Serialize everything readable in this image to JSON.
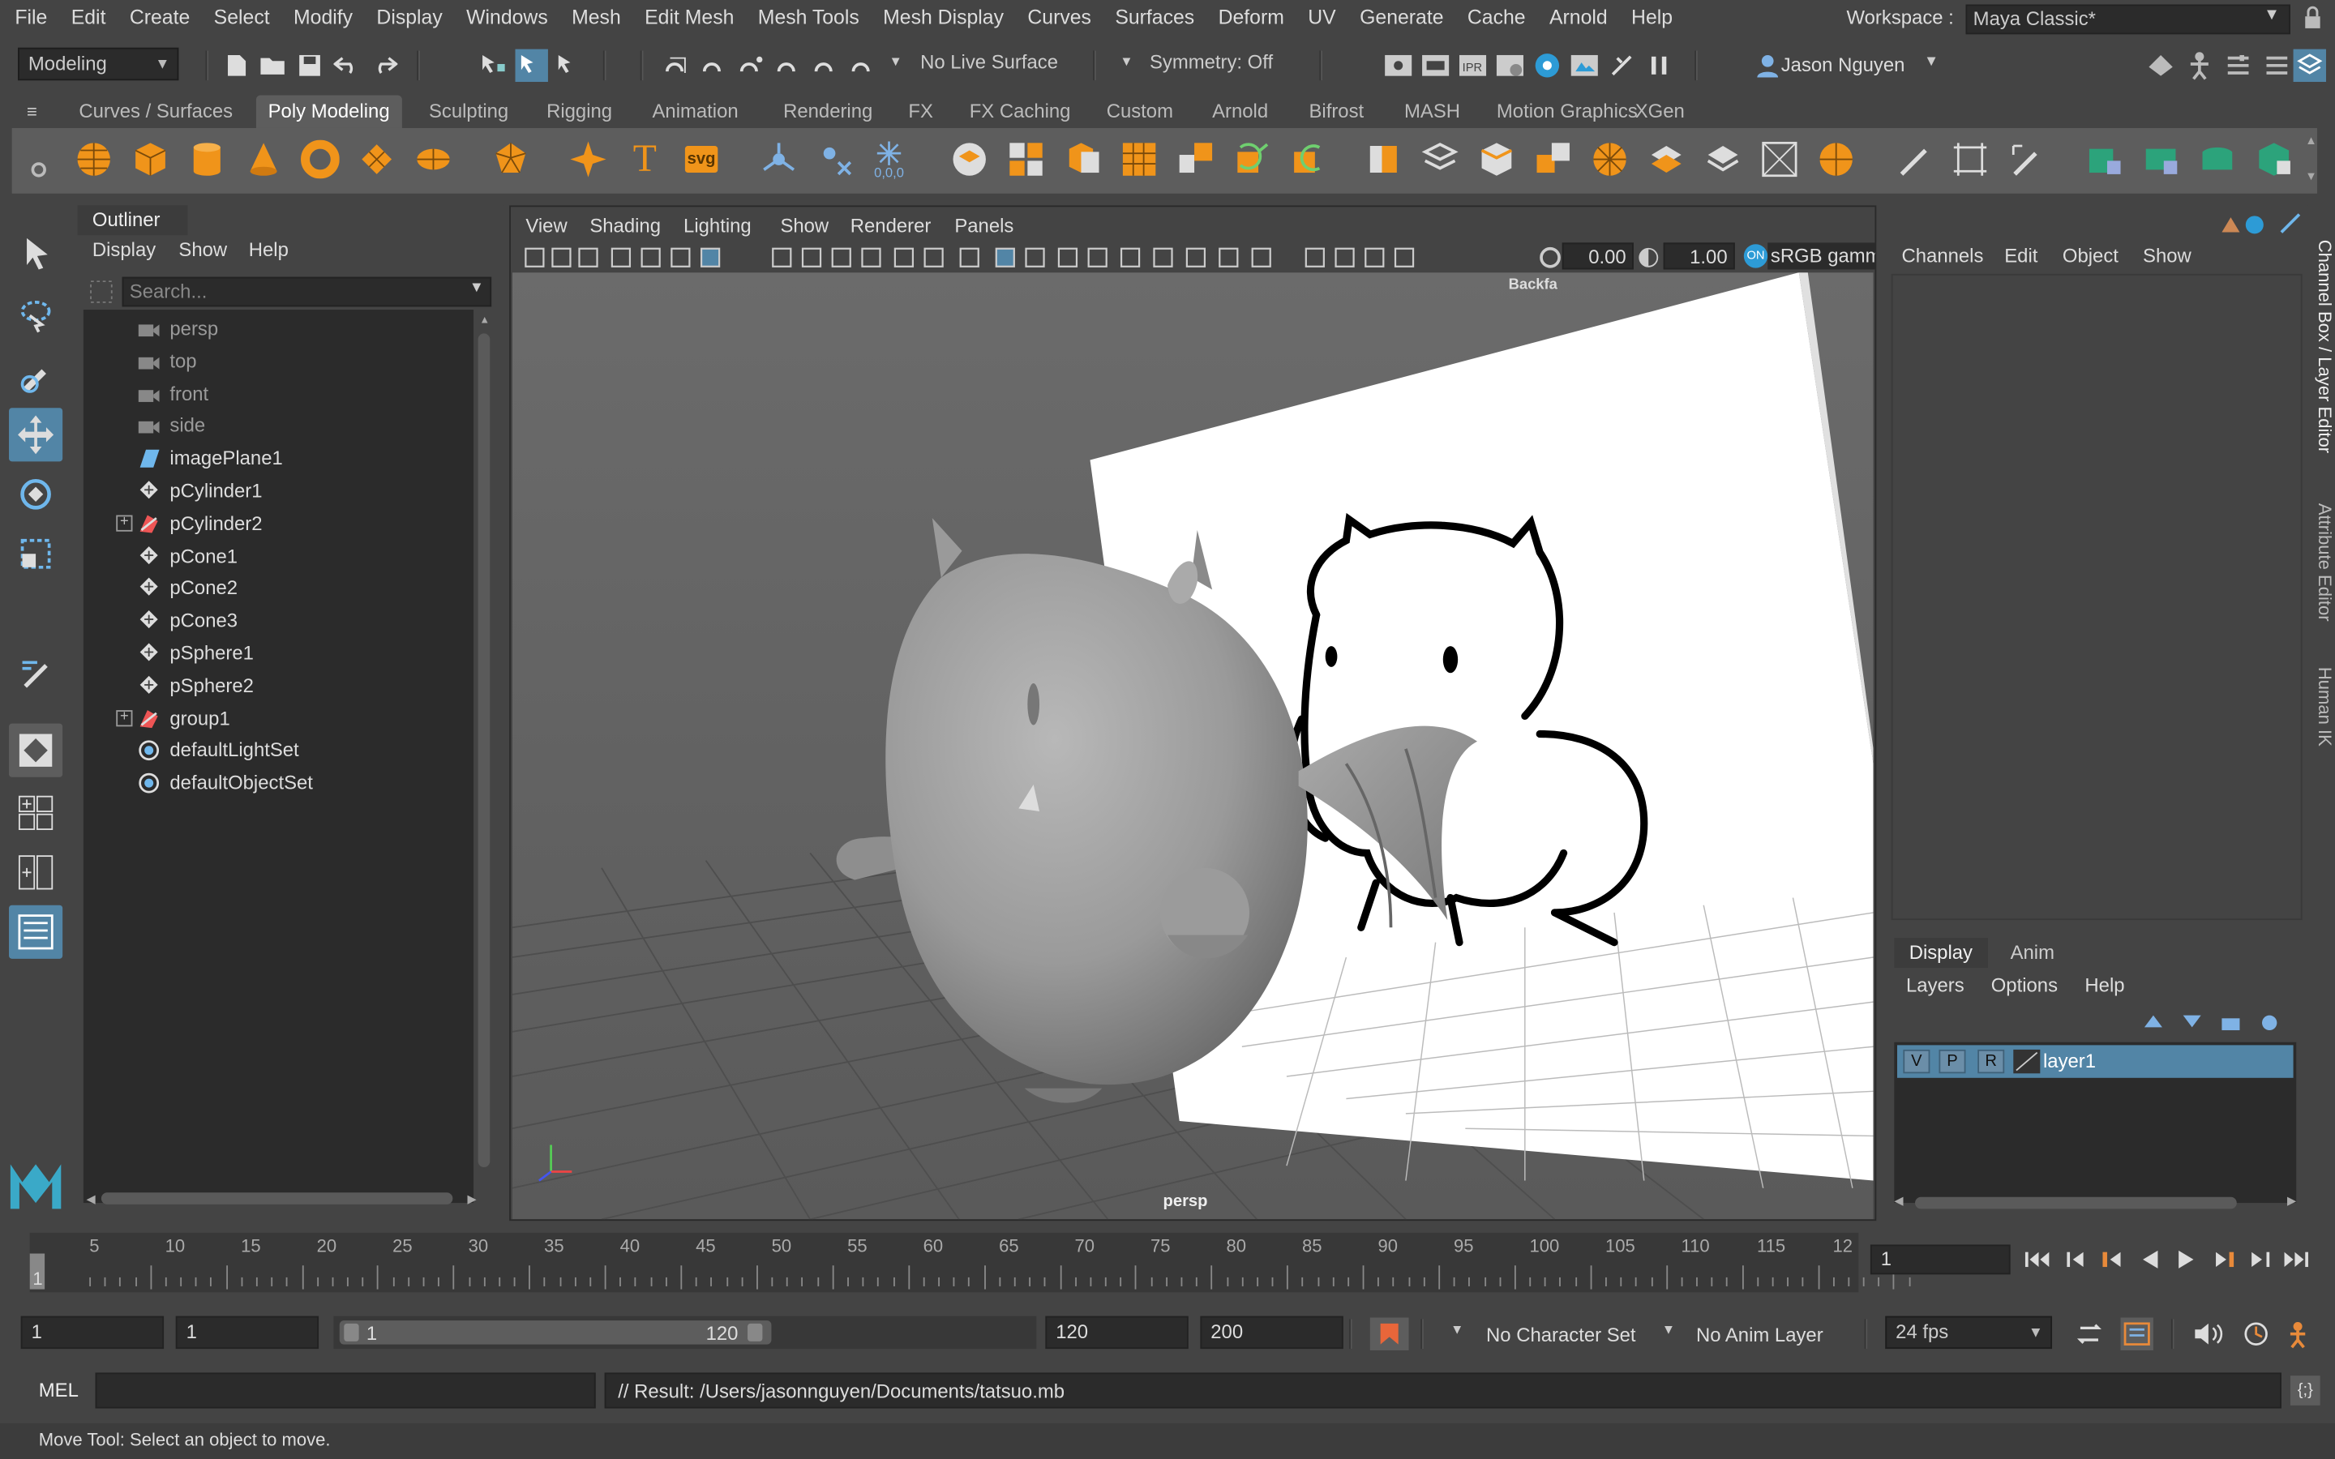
{
  "menubar": {
    "items": [
      "File",
      "Edit",
      "Create",
      "Select",
      "Modify",
      "Display",
      "Windows",
      "Mesh",
      "Edit Mesh",
      "Mesh Tools",
      "Mesh Display",
      "Curves",
      "Surfaces",
      "Deform",
      "UV",
      "Generate",
      "Cache",
      "Arnold",
      "Help"
    ],
    "workspace_label": "Workspace :",
    "workspace_value": "Maya Classic*"
  },
  "statusline": {
    "menuset": "Modeling",
    "live_surface": "No Live Surface",
    "symmetry": "Symmetry: Off",
    "user": "Jason Nguyen"
  },
  "shelf": {
    "tabs": [
      "Curves / Surfaces",
      "Poly Modeling",
      "Sculpting",
      "Rigging",
      "Animation",
      "Rendering",
      "FX",
      "FX Caching",
      "Custom",
      "Arnold",
      "Bifrost",
      "MASH",
      "Motion Graphics",
      "XGen"
    ],
    "active_tab": "Poly Modeling",
    "svg_label": "svg",
    "coords_label": "0,0,0"
  },
  "outliner": {
    "title": "Outliner",
    "menu": [
      "Display",
      "Show",
      "Help"
    ],
    "search_placeholder": "Search...",
    "items": [
      {
        "name": "persp",
        "kind": "camera"
      },
      {
        "name": "top",
        "kind": "camera"
      },
      {
        "name": "front",
        "kind": "camera"
      },
      {
        "name": "side",
        "kind": "camera"
      },
      {
        "name": "imagePlane1",
        "kind": "imageplane"
      },
      {
        "name": "pCylinder1",
        "kind": "mesh"
      },
      {
        "name": "pCylinder2",
        "kind": "group"
      },
      {
        "name": "pCone1",
        "kind": "mesh"
      },
      {
        "name": "pCone2",
        "kind": "mesh"
      },
      {
        "name": "pCone3",
        "kind": "mesh"
      },
      {
        "name": "pSphere1",
        "kind": "mesh"
      },
      {
        "name": "pSphere2",
        "kind": "mesh"
      },
      {
        "name": "group1",
        "kind": "group"
      },
      {
        "name": "defaultLightSet",
        "kind": "set"
      },
      {
        "name": "defaultObjectSet",
        "kind": "set"
      }
    ]
  },
  "viewport": {
    "menu": [
      "View",
      "Shading",
      "Lighting",
      "Show",
      "Renderer",
      "Panels"
    ],
    "exposure": "0.00",
    "gamma": "1.00",
    "colorspace": "sRGB gamm",
    "camera_label": "persp",
    "hud_label": "Backfa"
  },
  "channelbox": {
    "menu": [
      "Channels",
      "Edit",
      "Object",
      "Show"
    ],
    "layer_tabs": [
      "Display",
      "Anim"
    ],
    "layer_menu": [
      "Layers",
      "Options",
      "Help"
    ],
    "layer": {
      "v": "V",
      "p": "P",
      "r": "R",
      "name": "layer1"
    }
  },
  "side_tabs": [
    "Channel Box / Layer Editor",
    "Attribute Editor",
    "Human IK"
  ],
  "timeslider": {
    "ticks": [
      "5",
      "10",
      "15",
      "20",
      "25",
      "30",
      "35",
      "40",
      "45",
      "50",
      "55",
      "60",
      "65",
      "70",
      "75",
      "80",
      "85",
      "90",
      "95",
      "100",
      "105",
      "110",
      "115",
      "12"
    ],
    "start_tick": "1",
    "current_frame": "1"
  },
  "range": {
    "start": "1",
    "playback_start": "1",
    "slider_start": "1",
    "slider_end": "120",
    "playback_end": "120",
    "end": "200",
    "character_set": "No Character Set",
    "anim_layer": "No Anim Layer",
    "fps": "24 fps"
  },
  "cmdline": {
    "lang": "MEL",
    "result": "// Result: /Users/jasonnguyen/Documents/tatsuo.mb"
  },
  "helpline": {
    "text": "Move Tool: Select an object to move."
  },
  "colors": {
    "accent": "#5285a6",
    "panel": "#444444",
    "field": "#2b2b2b"
  }
}
